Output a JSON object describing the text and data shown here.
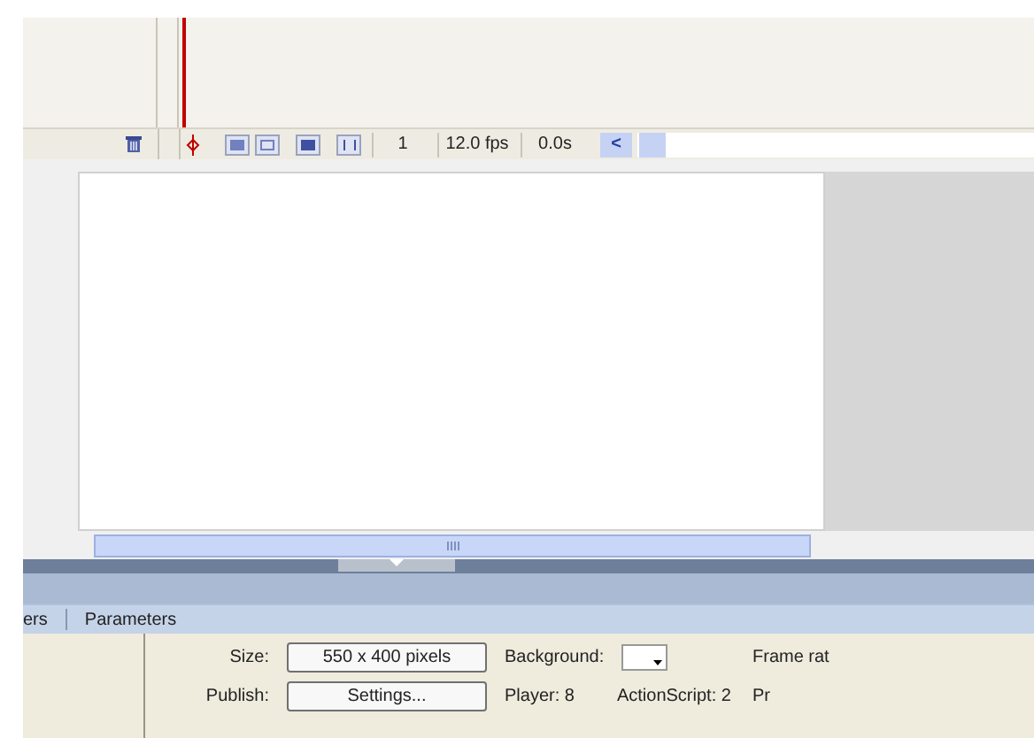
{
  "timeline": {
    "frame_number": "1",
    "frame_rate": "12.0 fps",
    "elapsed_time": "0.0s",
    "scroll_left": "<"
  },
  "panel_tabs": [
    "ers",
    "Parameters"
  ],
  "properties": {
    "size_label": "Size:",
    "size_value": "550 x 400 pixels",
    "background_label": "Background:",
    "frame_rate_label": "Frame rat",
    "publish_label": "Publish:",
    "settings_button": "Settings...",
    "player": "Player: 8",
    "actionscript": "ActionScript: 2",
    "profile": "Pr"
  }
}
